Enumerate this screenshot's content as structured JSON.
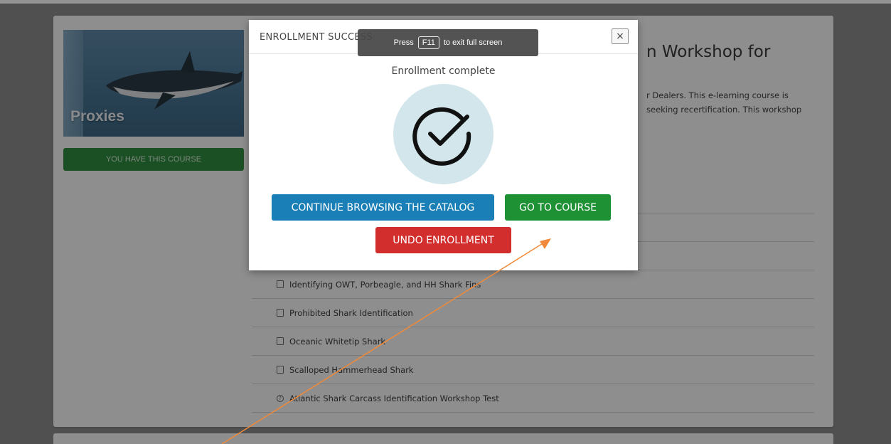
{
  "background": {
    "thumbnail_label": "Proxies",
    "have_course_label": "YOU HAVE THIS COURSE",
    "course_title_partial": "n Workshop for",
    "description_lines": [
      "r Dealers. This e-learning course is",
      "seeking recertification. This workshop"
    ],
    "lessons": [
      {
        "label": "",
        "icon": "document-icon"
      },
      {
        "label": "",
        "icon": "document-icon"
      },
      {
        "label": "",
        "icon": "document-icon"
      },
      {
        "label": "Identifying OWT, Porbeagle, and HH Shark Fins",
        "icon": "document-icon"
      },
      {
        "label": "Prohibited Shark Identification",
        "icon": "document-icon"
      },
      {
        "label": "Oceanic Whitetip Shark",
        "icon": "document-icon"
      },
      {
        "label": "Scalloped Hammerhead Shark",
        "icon": "document-icon"
      },
      {
        "label": "Atlantic Shark Carcass Identification Workshop Test",
        "icon": "quiz-icon"
      }
    ]
  },
  "modal": {
    "title": "ENROLLMENT SUCCESS",
    "close_label": "×",
    "status": "Enrollment complete",
    "continue_label": "CONTINUE BROWSING THE CATALOG",
    "go_label": "GO TO COURSE",
    "undo_label": "UNDO ENROLLMENT"
  },
  "fullscreen_tip": {
    "press": "Press",
    "key": "F11",
    "rest": "to exit full screen"
  },
  "colors": {
    "continue": "#1a7fb6",
    "go": "#1f9135",
    "undo": "#d22e2e",
    "check_circle": "#d3e6ec",
    "annotation_arrow": "#f08a3a"
  }
}
